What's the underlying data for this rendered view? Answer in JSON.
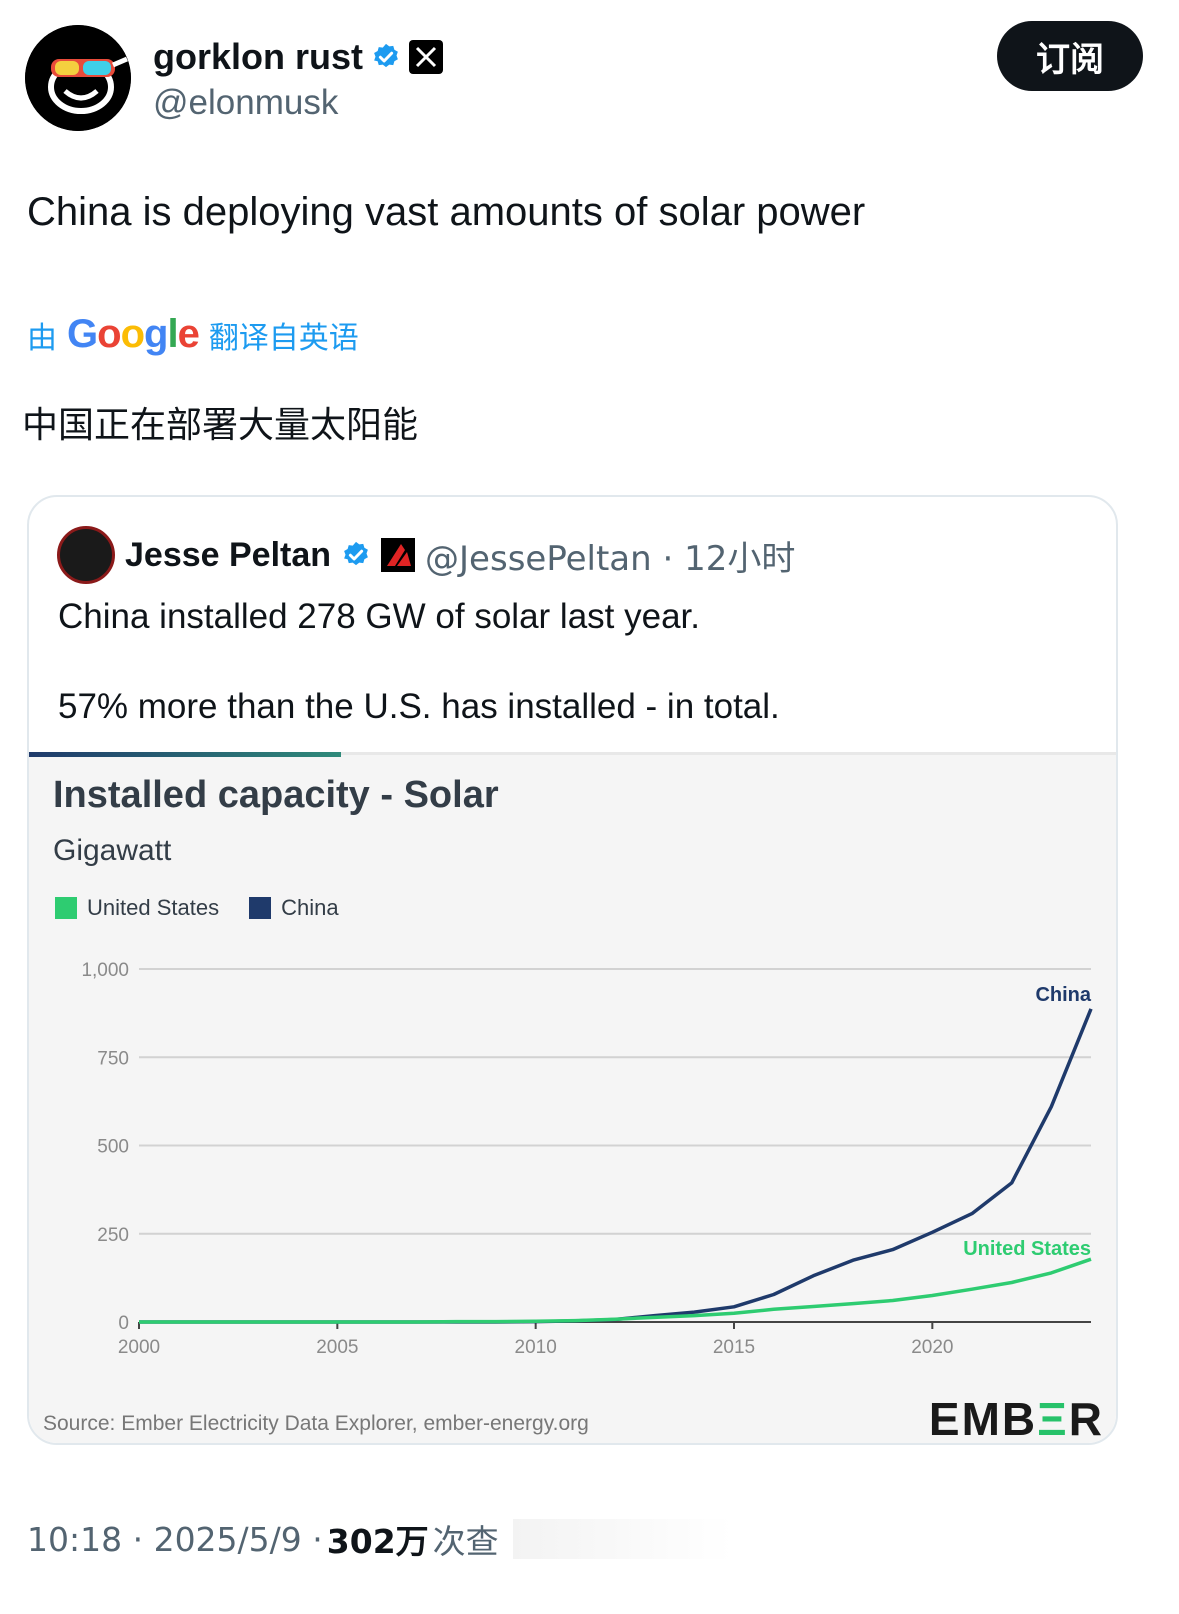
{
  "author": {
    "display_name": "gorklon rust",
    "handle": "@elonmusk",
    "verified_icon": "verified-badge-icon",
    "affiliate_badge": "x-logo-icon"
  },
  "subscribe_label": "订阅",
  "tweet_text": "China is deploying vast amounts of solar power",
  "translation": {
    "prefix": "由",
    "provider": "Google",
    "suffix": "翻译自英语",
    "translated_text": "中国正在部署大量太阳能"
  },
  "quote": {
    "display_name": "Jesse Peltan",
    "handle_time": "@JessePeltan · 12小时",
    "line1": "China installed 278 GW of solar last year.",
    "line2": "57% more than the U.S. has installed - in total."
  },
  "footer": {
    "time_date": "10:18 · 2025/5/9 ·",
    "views": "302万",
    "views_label": "次查"
  },
  "colors": {
    "china": "#1f3a6b",
    "united_states": "#2ecc71",
    "link_blue": "#1d9bf0"
  },
  "chart_data": {
    "type": "line",
    "title": "Installed capacity - Solar",
    "subtitle": "Gigawatt",
    "legend": [
      "United States",
      "China"
    ],
    "x": [
      2000,
      2001,
      2002,
      2003,
      2004,
      2005,
      2006,
      2007,
      2008,
      2009,
      2010,
      2011,
      2012,
      2013,
      2014,
      2015,
      2016,
      2017,
      2018,
      2019,
      2020,
      2021,
      2022,
      2023,
      2024
    ],
    "series": [
      {
        "name": "China",
        "label": "China",
        "color": "#1f3a6b",
        "values": [
          0,
          0,
          0,
          0,
          0,
          0,
          0,
          0,
          0,
          0,
          1,
          3,
          7,
          18,
          28,
          43,
          78,
          131,
          175,
          205,
          254,
          307,
          394,
          610,
          887
        ]
      },
      {
        "name": "United States",
        "label": "United States",
        "color": "#2ecc71",
        "values": [
          0,
          0,
          0,
          0,
          0,
          0,
          0,
          0,
          1,
          1,
          2,
          4,
          8,
          13,
          18,
          25,
          36,
          44,
          52,
          61,
          75,
          93,
          112,
          139,
          178
        ]
      }
    ],
    "xticks": [
      2000,
      2005,
      2010,
      2015,
      2020
    ],
    "yticks": [
      "0",
      "250",
      "500",
      "750",
      "1,000"
    ],
    "ytick_values": [
      0,
      250,
      500,
      750,
      1000
    ],
    "ylim": [
      0,
      1000
    ],
    "xlim": [
      2000,
      2024
    ],
    "grid": true,
    "source": "Source: Ember Electricity Data Explorer, ember-energy.org",
    "brand": {
      "pre": "EMB",
      "mid": "Ξ",
      "post": "R"
    }
  }
}
